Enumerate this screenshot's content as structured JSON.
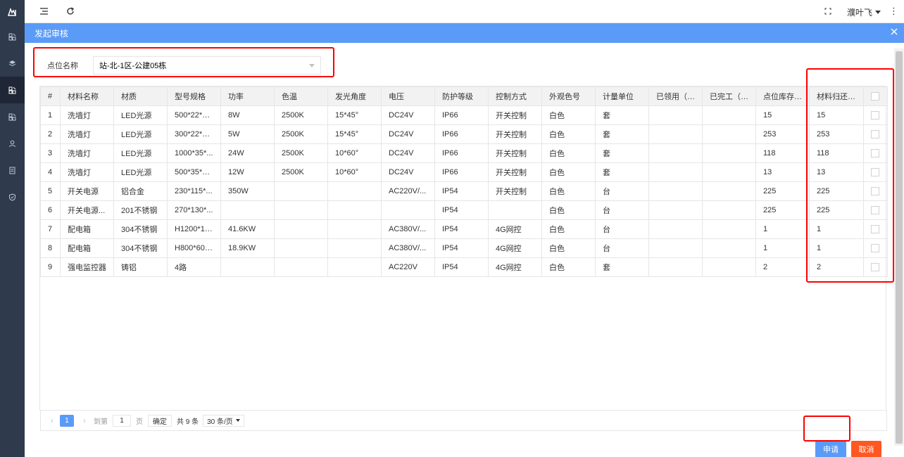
{
  "topbar": {
    "username": "濮叶飞",
    "more": "⋮"
  },
  "dialog": {
    "title": "发起审核",
    "form": {
      "label": "点位名称",
      "selected_value": "站-北-1区-公建05栋"
    },
    "columns": [
      "#",
      "材料名称",
      "材质",
      "型号规格",
      "功率",
      "色温",
      "发光角度",
      "电压",
      "防护等级",
      "控制方式",
      "外观色号",
      "计量单位",
      "已领用（…",
      "已完工（…",
      "点位库存…",
      "材料归还…"
    ],
    "rows": [
      [
        "1",
        "洗墙灯",
        "LED光源",
        "500*22*H...",
        "8W",
        "2500K",
        "15*45°",
        "DC24V",
        "IP66",
        "开关控制",
        "白色",
        "套",
        "",
        "",
        "15",
        "15"
      ],
      [
        "2",
        "洗墙灯",
        "LED光源",
        "300*22*H...",
        "5W",
        "2500K",
        "15*45°",
        "DC24V",
        "IP66",
        "开关控制",
        "白色",
        "套",
        "",
        "",
        "253",
        "253"
      ],
      [
        "3",
        "洗墙灯",
        "LED光源",
        "1000*35*...",
        "24W",
        "2500K",
        "10*60°",
        "DC24V",
        "IP66",
        "开关控制",
        "白色",
        "套",
        "",
        "",
        "118",
        "118"
      ],
      [
        "4",
        "洗墙灯",
        "LED光源",
        "500*35*H...",
        "12W",
        "2500K",
        "10*60°",
        "DC24V",
        "IP66",
        "开关控制",
        "白色",
        "套",
        "",
        "",
        "13",
        "13"
      ],
      [
        "5",
        "开关电源",
        "铝合金",
        "230*115*...",
        "350W",
        "",
        "",
        "AC220V/...",
        "IP54",
        "开关控制",
        "白色",
        "台",
        "",
        "",
        "225",
        "225"
      ],
      [
        "6",
        "开关电源...",
        "201不锈钢",
        "270*130*...",
        "",
        "",
        "",
        "",
        "IP54",
        "",
        "白色",
        "台",
        "",
        "",
        "225",
        "225"
      ],
      [
        "7",
        "配电箱",
        "304不锈钢",
        "H1200*10...",
        "41.6KW",
        "",
        "",
        "AC380V/...",
        "IP54",
        "4G网控",
        "白色",
        "台",
        "",
        "",
        "1",
        "1"
      ],
      [
        "8",
        "配电箱",
        "304不锈钢",
        "H800*600...",
        "18.9KW",
        "",
        "",
        "AC380V/...",
        "IP54",
        "4G网控",
        "白色",
        "台",
        "",
        "",
        "1",
        "1"
      ],
      [
        "9",
        "强电监控器",
        "铸铝",
        "4路",
        "",
        "",
        "",
        "AC220V",
        "IP54",
        "4G网控",
        "白色",
        "套",
        "",
        "",
        "2",
        "2"
      ]
    ],
    "pager": {
      "current_page": "1",
      "goto_prefix": "到第",
      "goto_value": "1",
      "goto_suffix": "页",
      "confirm_label": "确定",
      "total": "共 9 条",
      "page_size": "30 条/页"
    },
    "apply_label": "申请",
    "cancel_label": "取消"
  },
  "colors": {
    "primary": "#5b9bf8",
    "danger": "#ff5722",
    "sidebar": "#2f3a4d",
    "highlight": "#ff0000"
  }
}
